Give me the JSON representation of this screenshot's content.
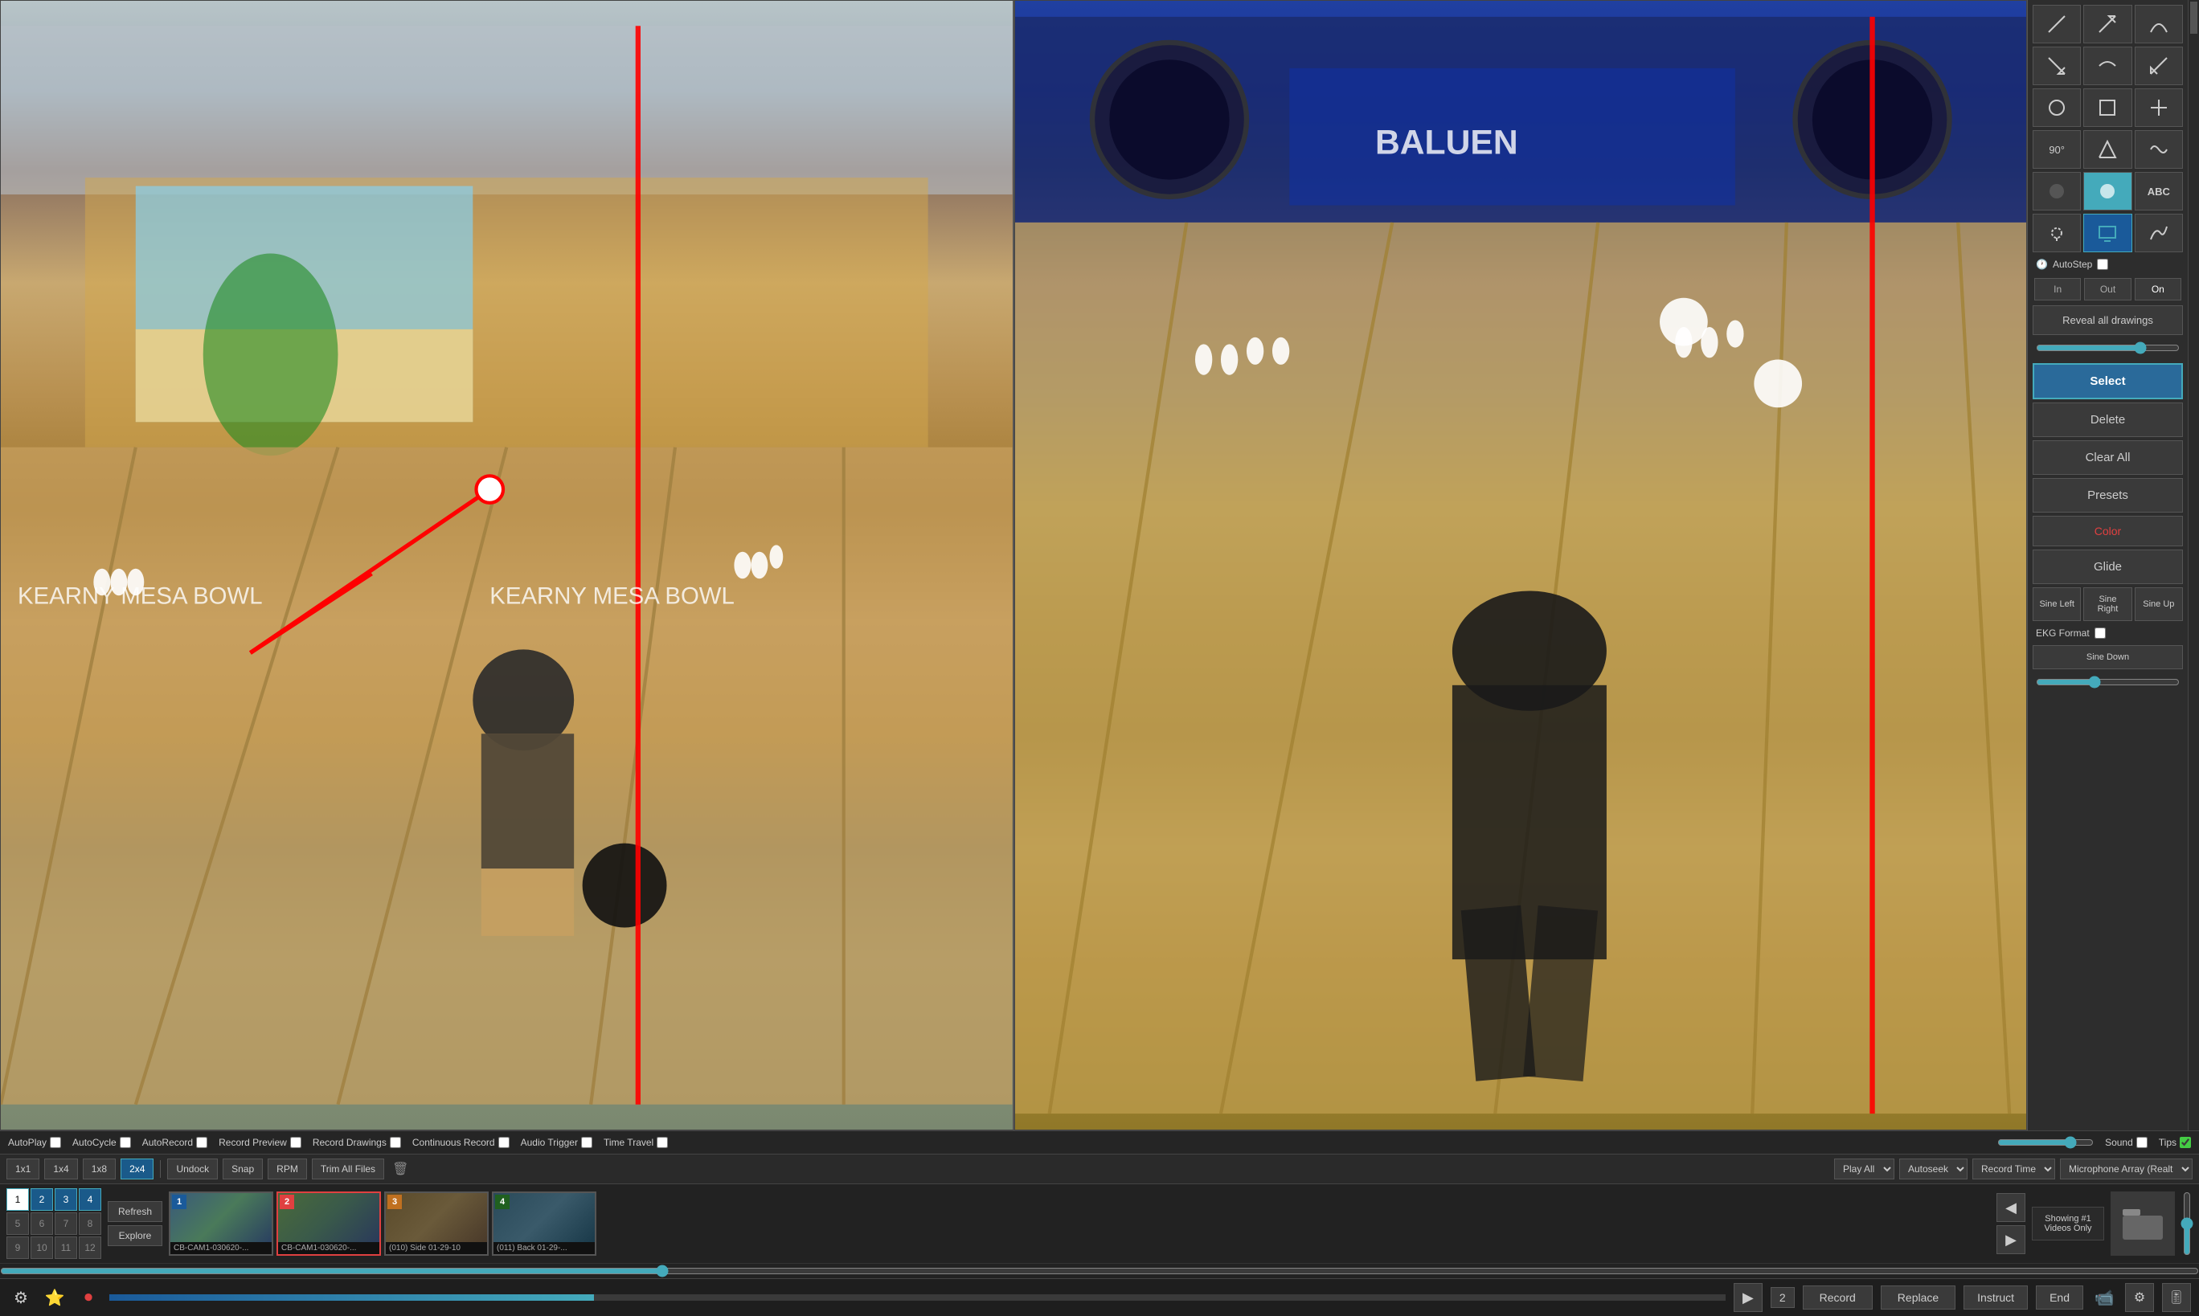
{
  "toolbar": {
    "autoplay_label": "AutoPlay",
    "autocycle_label": "AutoCycle",
    "autorecord_label": "AutoRecord",
    "record_preview_label": "Record Preview",
    "record_drawings_label": "Record Drawings",
    "continuous_record_label": "Continuous Record",
    "audio_trigger_label": "Audio Trigger",
    "time_travel_label": "Time Travel",
    "sound_label": "Sound",
    "tips_label": "Tips"
  },
  "buttons": {
    "1x1": "1x1",
    "1x4": "1x4",
    "1x8": "1x8",
    "2x4": "2x4",
    "undock": "Undock",
    "snap": "Snap",
    "rpm": "RPM",
    "trim_all": "Trim All Files",
    "play_all": "Play All",
    "autoseek": "Autoseek",
    "record_time": "Record Time",
    "microphone": "Microphone Array (Realt"
  },
  "right_panel": {
    "autostep_label": "AutoStep",
    "in_label": "In",
    "out_label": "Out",
    "on_label": "On",
    "reveal_label": "Reveal all drawings",
    "select_label": "Select",
    "delete_label": "Delete",
    "clear_all_label": "Clear All",
    "presets_label": "Presets",
    "color_label": "Color",
    "glide_label": "Glide",
    "sine_left": "Sine Left",
    "sine_right": "Sine Right",
    "sine_up": "Sine Up",
    "ekg_label": "EKG Format",
    "sine_down": "Sine Down"
  },
  "clips": {
    "refresh": "Refresh",
    "explore": "Explore",
    "showing": "Showing #1",
    "videos_only": "Videos Only",
    "items": [
      {
        "number": "1",
        "label": "CB-CAM1-030620-...",
        "color": "blue"
      },
      {
        "number": "2",
        "label": "CB-CAM1-030620-...",
        "color": "red"
      },
      {
        "number": "3",
        "label": "(010) Side 01-29-10",
        "color": "orange"
      },
      {
        "number": "4",
        "label": "(011) Back 01-29-...",
        "color": "green"
      }
    ]
  },
  "bottom_bar": {
    "play_label": "▶",
    "number": "2",
    "record_label": "Record",
    "replace_label": "Replace",
    "instruct_label": "Instruct",
    "end_label": "End"
  },
  "numbers": {
    "grid": [
      "1",
      "2",
      "3",
      "4",
      "5",
      "6",
      "7",
      "8",
      "9",
      "10",
      "11",
      "12"
    ]
  }
}
